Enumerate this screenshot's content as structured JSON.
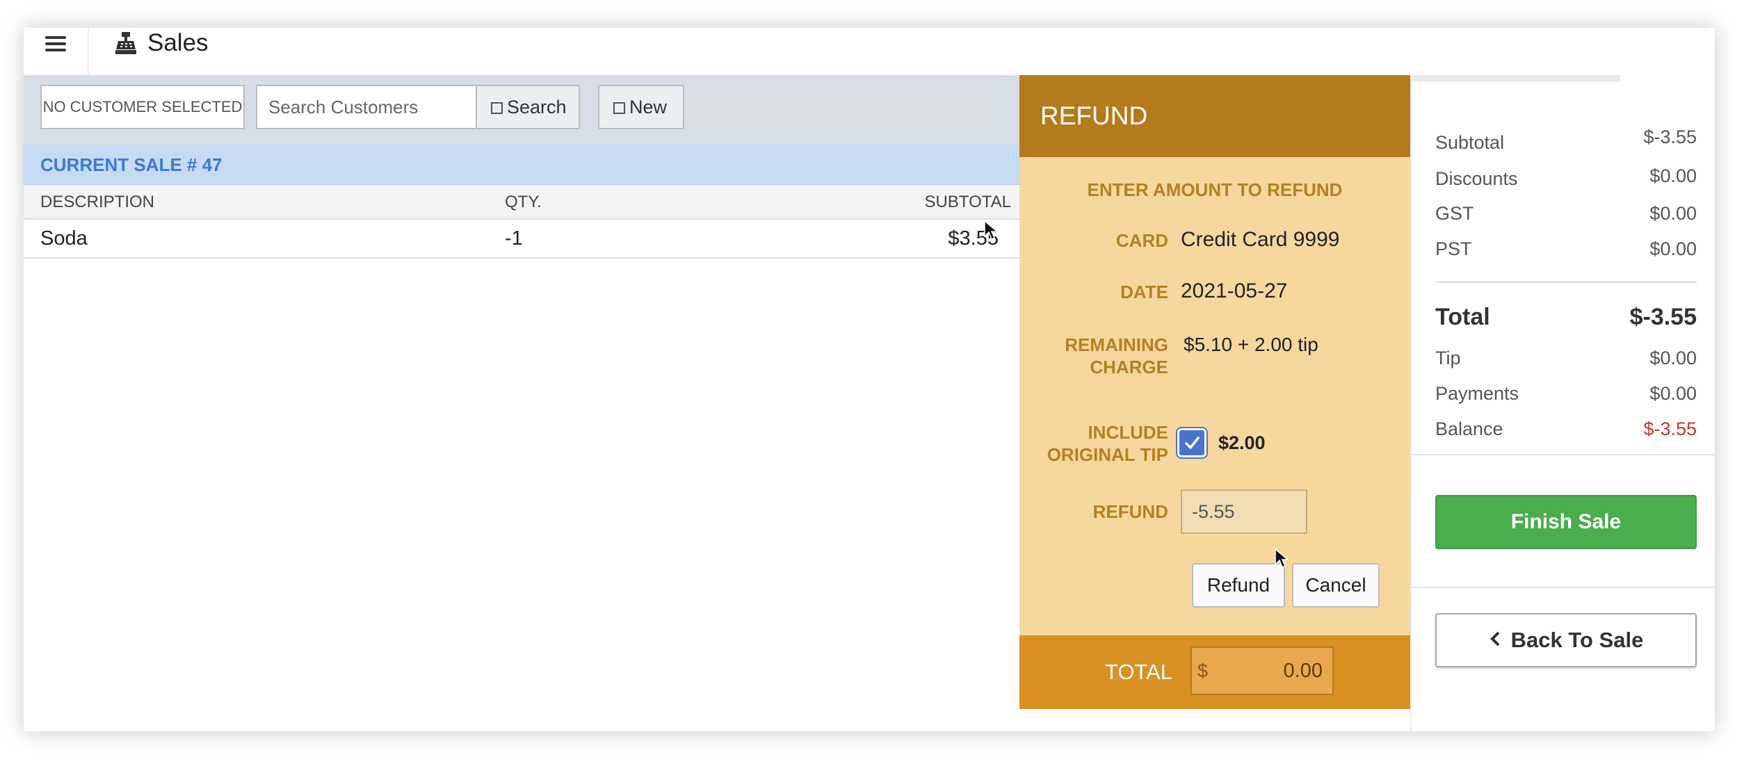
{
  "header": {
    "title": "Sales"
  },
  "customer": {
    "none_label": "NO CUSTOMER SELECTED",
    "search_placeholder": "Search Customers",
    "search_button": "Search",
    "new_button": "New"
  },
  "sale": {
    "header": "CURRENT SALE # 47",
    "columns": {
      "description": "DESCRIPTION",
      "qty": "QTY.",
      "subtotal": "SUBTOTAL"
    },
    "items": [
      {
        "description": "Soda",
        "qty": "-1",
        "subtotal": "$3.55"
      }
    ]
  },
  "refund": {
    "title": "REFUND",
    "subtitle": "ENTER AMOUNT TO REFUND",
    "card_label": "CARD",
    "card_value": "Credit Card 9999",
    "date_label": "DATE",
    "date_value": "2021-05-27",
    "remaining_label_1": "REMAINING",
    "remaining_label_2": "CHARGE",
    "remaining_value": "$5.10 + 2.00 tip",
    "tip_label_1": "INCLUDE",
    "tip_label_2": "ORIGINAL TIP",
    "tip_checked": true,
    "tip_value": "$2.00",
    "refund_label": "REFUND",
    "refund_value": "-5.55",
    "refund_button": "Refund",
    "cancel_button": "Cancel",
    "total_label": "TOTAL",
    "total_currency": "$",
    "total_value": "0.00"
  },
  "summary": {
    "subtotal_label": "Subtotal",
    "subtotal_value": "$-3.55",
    "discounts_label": "Discounts",
    "discounts_value": "$0.00",
    "gst_label": "GST",
    "gst_value": "$0.00",
    "pst_label": "PST",
    "pst_value": "$0.00",
    "total_label": "Total",
    "total_value": "$-3.55",
    "tip_label": "Tip",
    "tip_value": "$0.00",
    "payments_label": "Payments",
    "payments_value": "$0.00",
    "balance_label": "Balance",
    "balance_value": "$-3.55",
    "finish_button": "Finish Sale",
    "back_button": "Back To Sale"
  },
  "colors": {
    "refund_header": "#b57a1c",
    "refund_panel": "#f6d89f",
    "refund_footer": "#d89122",
    "finish_green": "#4aad4e",
    "balance_red": "#c0392b",
    "sale_header_blue": "#3b7bd1"
  }
}
